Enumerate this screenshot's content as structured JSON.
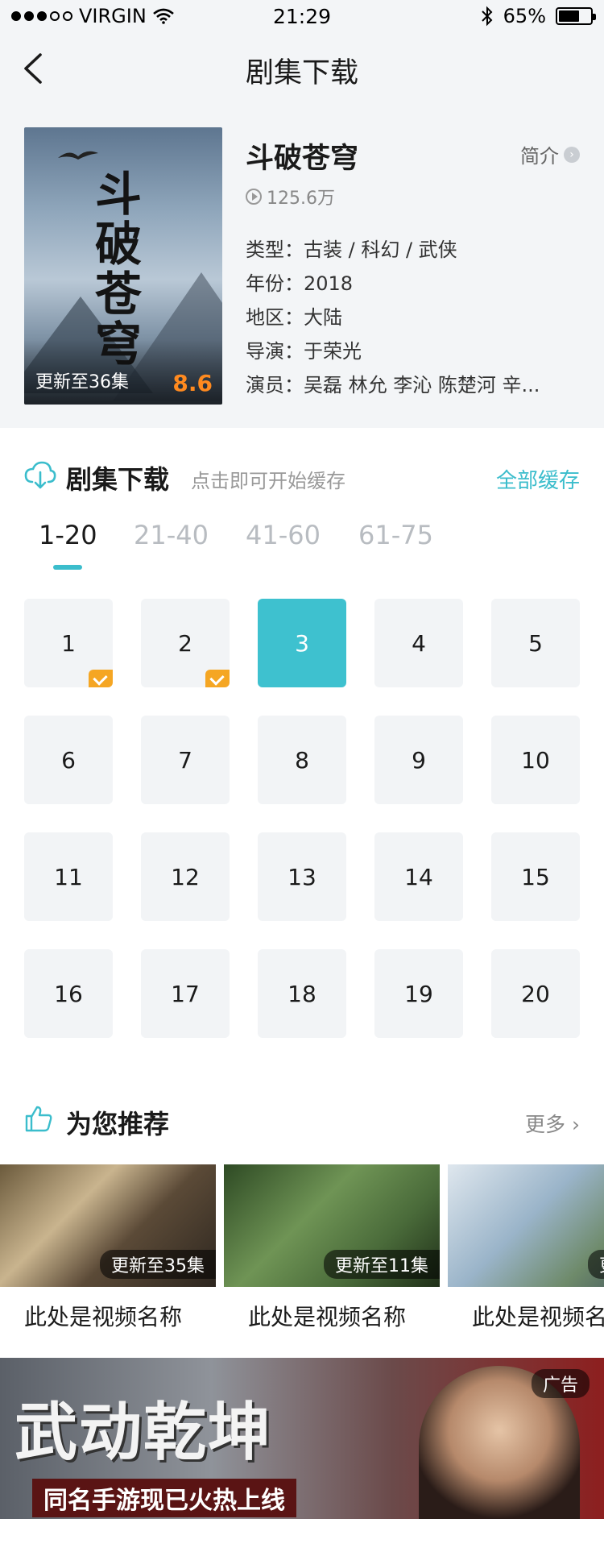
{
  "status_bar": {
    "carrier": "VIRGIN",
    "time": "21:29",
    "battery": "65%",
    "battery_level": 0.65
  },
  "nav": {
    "title": "剧集下载"
  },
  "show": {
    "title": "斗破苍穹",
    "poster_text": "斗破苍穹",
    "poster_update": "更新至36集",
    "score": "8.6",
    "plays": "125.6万",
    "intro_label": "简介",
    "meta": [
      {
        "label": "类型：",
        "value": "古装 / 科幻 / 武侠"
      },
      {
        "label": "年份：",
        "value": "2018"
      },
      {
        "label": "地区：",
        "value": "大陆"
      },
      {
        "label": "导演：",
        "value": "于荣光"
      },
      {
        "label": "演员：",
        "value": "吴磊  林允  李沁  陈楚河  辛..."
      }
    ]
  },
  "download": {
    "title": "剧集下载",
    "hint": "点击即可开始缓存",
    "cache_all": "全部缓存",
    "tabs": [
      "1-20",
      "21-40",
      "41-60",
      "61-75"
    ],
    "active_tab": 0,
    "episodes": [
      "1",
      "2",
      "3",
      "4",
      "5",
      "6",
      "7",
      "8",
      "9",
      "10",
      "11",
      "12",
      "13",
      "14",
      "15",
      "16",
      "17",
      "18",
      "19",
      "20"
    ],
    "downloaded": [
      "1",
      "2"
    ],
    "selected": "3"
  },
  "recommend": {
    "title": "为您推荐",
    "more": "更多",
    "items": [
      {
        "badge": "更新至35集",
        "name": "此处是视频名称"
      },
      {
        "badge": "更新至11集",
        "name": "此处是视频名称"
      },
      {
        "badge": "更新至",
        "name": "此处是视频名称"
      }
    ]
  },
  "ad": {
    "title": "武动乾坤",
    "subtitle": "同名手游现已火热上线",
    "tag": "广告"
  },
  "colors": {
    "accent": "#3bbdcc",
    "score": "#ff8a1f",
    "check": "#f5a623"
  }
}
